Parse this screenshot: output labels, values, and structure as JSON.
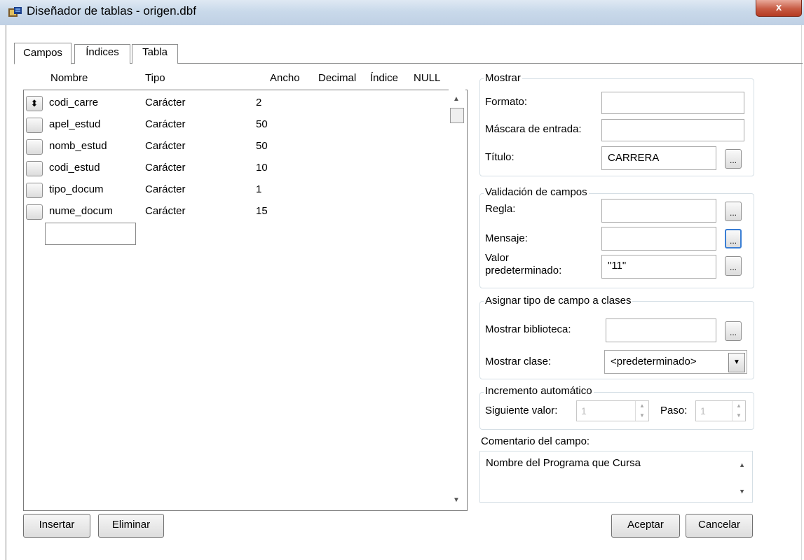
{
  "window": {
    "title": "Diseñador de tablas - origen.dbf",
    "close_glyph": "x"
  },
  "tabs": [
    {
      "label": "Campos",
      "active": true
    },
    {
      "label": "Índices",
      "active": false
    },
    {
      "label": "Tabla",
      "active": false
    }
  ],
  "grid": {
    "columns": [
      "Nombre",
      "Tipo",
      "Ancho",
      "Decimal",
      "Índice",
      "NULL"
    ],
    "rows": [
      {
        "nombre": "codi_carre",
        "tipo": "Carácter",
        "ancho": "2",
        "selected": true
      },
      {
        "nombre": "apel_estud",
        "tipo": "Carácter",
        "ancho": "50"
      },
      {
        "nombre": "nomb_estud",
        "tipo": "Carácter",
        "ancho": "50"
      },
      {
        "nombre": "codi_estud",
        "tipo": "Carácter",
        "ancho": "10"
      },
      {
        "nombre": "tipo_docum",
        "tipo": "Carácter",
        "ancho": "1"
      },
      {
        "nombre": "nume_docum",
        "tipo": "Carácter",
        "ancho": "15"
      }
    ],
    "selector_glyph": "⬍",
    "new_field_value": ""
  },
  "buttons": {
    "insertar": "Insertar",
    "eliminar": "Eliminar",
    "aceptar": "Aceptar",
    "cancelar": "Cancelar",
    "ellipsis": "..."
  },
  "mostrar": {
    "label": "Mostrar",
    "formato_label": "Formato:",
    "formato_value": "",
    "mascara_label": "Máscara de entrada:",
    "mascara_value": "",
    "titulo_label": "Título:",
    "titulo_value": "CARRERA"
  },
  "validacion": {
    "label": "Validación de campos",
    "regla_label": "Regla:",
    "regla_value": "",
    "mensaje_label": "Mensaje:",
    "mensaje_value": "",
    "valor_label_1": "Valor",
    "valor_label_2": "predeterminado:",
    "valor_value": "\"11\""
  },
  "asignar": {
    "label": "Asignar tipo de campo a clases",
    "biblioteca_label": "Mostrar biblioteca:",
    "biblioteca_value": "",
    "clase_label": "Mostrar clase:",
    "clase_value": "<predeterminado>"
  },
  "incremento": {
    "label": "Incremento automático",
    "siguiente_label": "Siguiente valor:",
    "siguiente_value": "1",
    "paso_label": "Paso:",
    "paso_value": "1"
  },
  "comentario": {
    "label": "Comentario del campo:",
    "value": "Nombre del Programa que Cursa"
  },
  "colors": {
    "titlebar": "#c9d9ea",
    "close": "#c75b43",
    "focus": "#3a7ed4"
  }
}
